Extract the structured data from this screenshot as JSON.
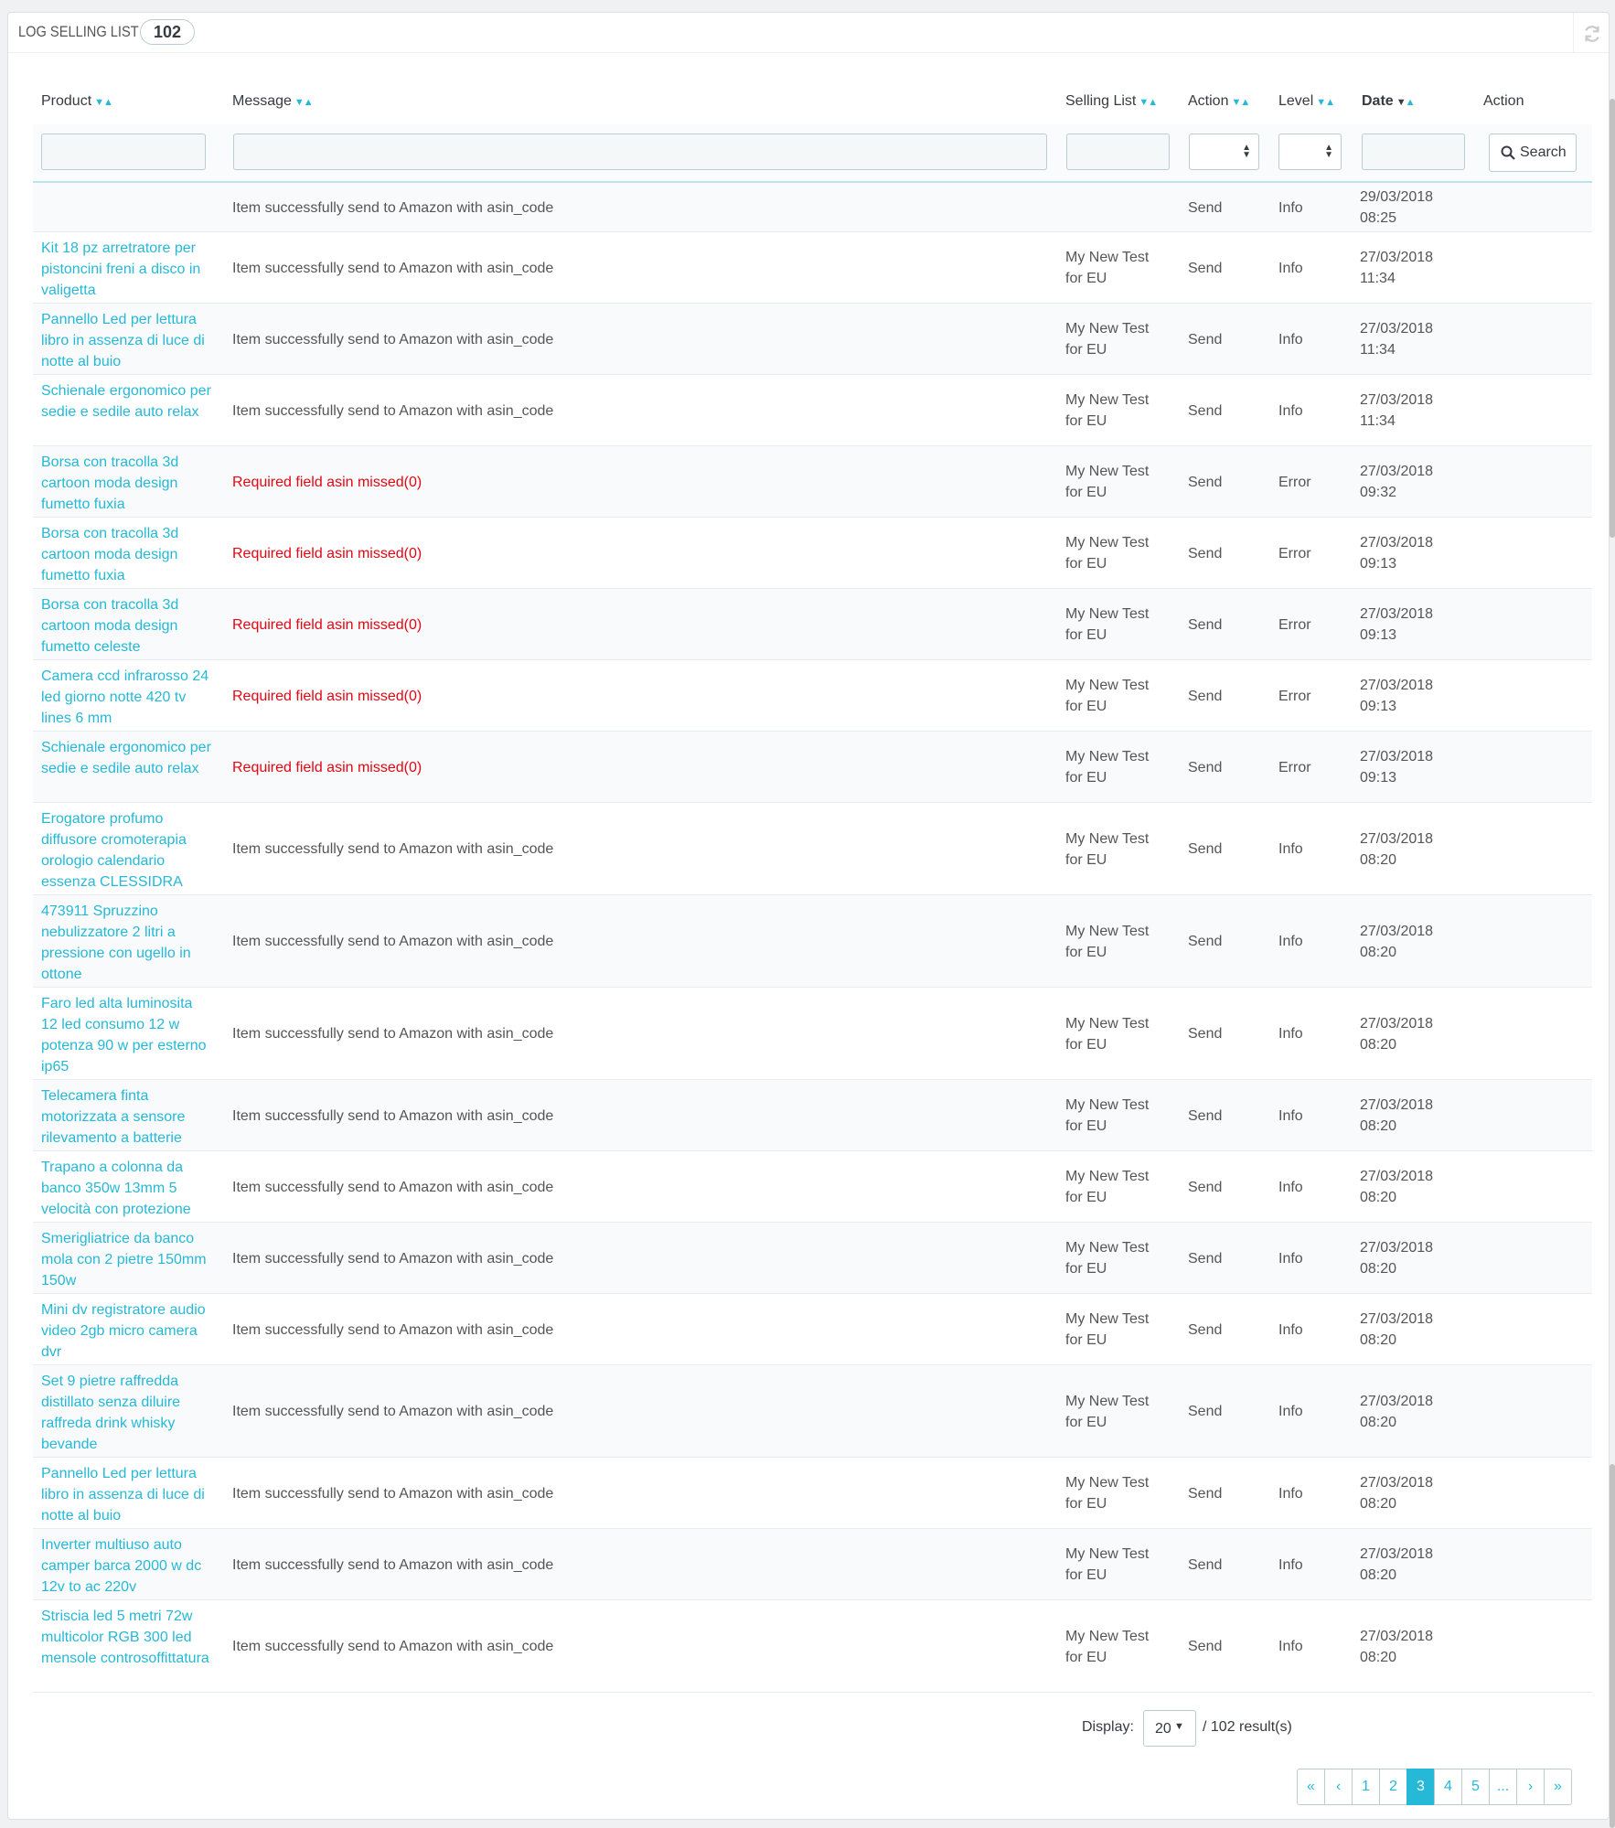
{
  "panel": {
    "title": "LOG SELLING LIST",
    "count": "102"
  },
  "headers": {
    "product": "Product",
    "message": "Message",
    "selling_list": "Selling List",
    "action": "Action",
    "level": "Level",
    "date": "Date",
    "action2": "Action"
  },
  "filters": {
    "search_label": "Search"
  },
  "rows": [
    {
      "product": "",
      "message": "Item successfully send to Amazon with asin_code",
      "list": "",
      "action": "Send",
      "level": "Info",
      "date": "29/03/2018\n08:25",
      "error": false
    },
    {
      "product": "Kit 18 pz arretratore per pistoncini freni a disco in valigetta",
      "message": "Item successfully send to Amazon with asin_code",
      "list": "My New Test\nfor EU",
      "action": "Send",
      "level": "Info",
      "date": "27/03/2018\n11:34",
      "error": false
    },
    {
      "product": "Pannello Led per lettura libro in assenza di luce di notte al buio",
      "message": "Item successfully send to Amazon with asin_code",
      "list": "My New Test\nfor EU",
      "action": "Send",
      "level": "Info",
      "date": "27/03/2018\n11:34",
      "error": false
    },
    {
      "product": "Schienale ergonomico per sedie e sedile auto relax",
      "message": "Item successfully send to Amazon with asin_code",
      "list": "My New Test\nfor EU",
      "action": "Send",
      "level": "Info",
      "date": "27/03/2018\n11:34",
      "error": false
    },
    {
      "product": "Borsa con tracolla 3d cartoon moda design fumetto fuxia",
      "message": "Required field asin missed(0)",
      "list": "My New Test\nfor EU",
      "action": "Send",
      "level": "Error",
      "date": "27/03/2018\n09:32",
      "error": true
    },
    {
      "product": "Borsa con tracolla 3d cartoon moda design fumetto fuxia",
      "message": "Required field asin missed(0)",
      "list": "My New Test\nfor EU",
      "action": "Send",
      "level": "Error",
      "date": "27/03/2018\n09:13",
      "error": true
    },
    {
      "product": "Borsa con tracolla 3d cartoon moda design fumetto celeste",
      "message": "Required field asin missed(0)",
      "list": "My New Test\nfor EU",
      "action": "Send",
      "level": "Error",
      "date": "27/03/2018\n09:13",
      "error": true
    },
    {
      "product": "Camera ccd infrarosso 24 led giorno notte 420 tv lines 6 mm",
      "message": "Required field asin missed(0)",
      "list": "My New Test\nfor EU",
      "action": "Send",
      "level": "Error",
      "date": "27/03/2018\n09:13",
      "error": true
    },
    {
      "product": "Schienale ergonomico per sedie e sedile auto relax",
      "message": "Required field asin missed(0)",
      "list": "My New Test\nfor EU",
      "action": "Send",
      "level": "Error",
      "date": "27/03/2018\n09:13",
      "error": true
    },
    {
      "product": "Erogatore profumo diffusore cromoterapia orologio calendario essenza CLESSIDRA",
      "message": "Item successfully send to Amazon with asin_code",
      "list": "My New Test\nfor EU",
      "action": "Send",
      "level": "Info",
      "date": "27/03/2018\n08:20",
      "error": false
    },
    {
      "product": "473911 Spruzzino nebulizzatore 2 litri a pressione con ugello in ottone",
      "message": "Item successfully send to Amazon with asin_code",
      "list": "My New Test\nfor EU",
      "action": "Send",
      "level": "Info",
      "date": "27/03/2018\n08:20",
      "error": false
    },
    {
      "product": "Faro led alta luminosita 12 led consumo 12 w potenza 90 w per esterno ip65",
      "message": "Item successfully send to Amazon with asin_code",
      "list": "My New Test\nfor EU",
      "action": "Send",
      "level": "Info",
      "date": "27/03/2018\n08:20",
      "error": false
    },
    {
      "product": "Telecamera finta motorizzata a sensore rilevamento a batterie",
      "message": "Item successfully send to Amazon with asin_code",
      "list": "My New Test\nfor EU",
      "action": "Send",
      "level": "Info",
      "date": "27/03/2018\n08:20",
      "error": false
    },
    {
      "product": "Trapano a colonna da banco 350w 13mm 5 velocità con protezione",
      "message": "Item successfully send to Amazon with asin_code",
      "list": "My New Test\nfor EU",
      "action": "Send",
      "level": "Info",
      "date": "27/03/2018\n08:20",
      "error": false
    },
    {
      "product": "Smerigliatrice da banco mola con 2 pietre 150mm 150w",
      "message": "Item successfully send to Amazon with asin_code",
      "list": "My New Test\nfor EU",
      "action": "Send",
      "level": "Info",
      "date": "27/03/2018\n08:20",
      "error": false
    },
    {
      "product": "Mini dv registratore audio video 2gb micro camera dvr",
      "message": "Item successfully send to Amazon with asin_code",
      "list": "My New Test\nfor EU",
      "action": "Send",
      "level": "Info",
      "date": "27/03/2018\n08:20",
      "error": false
    },
    {
      "product": "Set 9 pietre raffredda distillato senza diluire raffreda drink whisky bevande",
      "message": "Item successfully send to Amazon with asin_code",
      "list": "My New Test\nfor EU",
      "action": "Send",
      "level": "Info",
      "date": "27/03/2018\n08:20",
      "error": false
    },
    {
      "product": "Pannello Led per lettura libro in assenza di luce di notte al buio",
      "message": "Item successfully send to Amazon with asin_code",
      "list": "My New Test\nfor EU",
      "action": "Send",
      "level": "Info",
      "date": "27/03/2018\n08:20",
      "error": false
    },
    {
      "product": "Inverter multiuso auto camper barca 2000 w dc 12v to ac 220v",
      "message": "Item successfully send to Amazon with asin_code",
      "list": "My New Test\nfor EU",
      "action": "Send",
      "level": "Info",
      "date": "27/03/2018\n08:20",
      "error": false
    },
    {
      "product": "Striscia led 5 metri 72w multicolor RGB 300 led mensole controsoffittatura",
      "message": "Item successfully send to Amazon with asin_code",
      "list": "My New Test\nfor EU",
      "action": "Send",
      "level": "Info",
      "date": "27/03/2018\n08:20",
      "error": false
    }
  ],
  "footer": {
    "display_label": "Display:",
    "display_value": "20",
    "results": "/ 102 result(s)",
    "pages": [
      "«",
      "‹",
      "1",
      "2",
      "3",
      "4",
      "5",
      "...",
      "›",
      "»"
    ],
    "active_page": "3"
  },
  "colors": {
    "link": "#25b9d7",
    "error": "#e30613",
    "border": "#bbcdd2"
  },
  "icons": {
    "refresh": "refresh-icon",
    "search": "search-icon"
  }
}
